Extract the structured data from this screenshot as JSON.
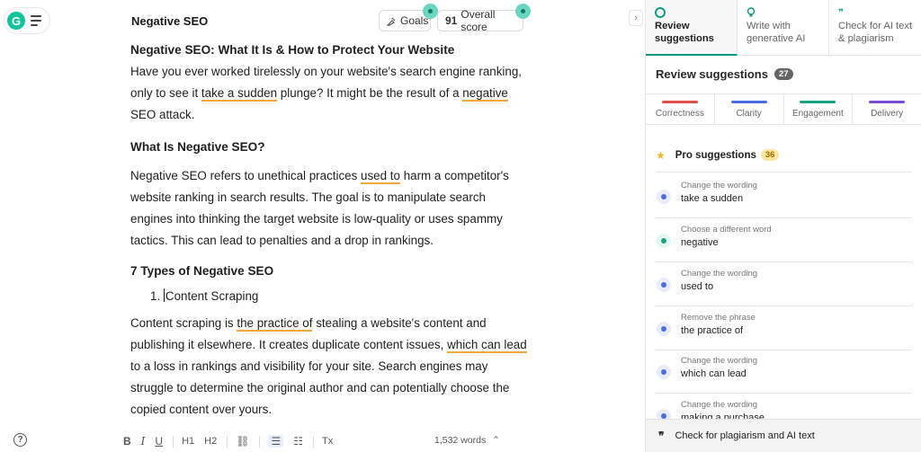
{
  "app": {
    "logo_letter": "G"
  },
  "editor": {
    "doc_title": "Negative SEO",
    "goals_label": "Goals",
    "score_value": "91",
    "score_label": "Overall score",
    "heading1": "Negative SEO: What It Is & How to Protect Your Website",
    "p1": {
      "a": "Have you ever worked tirelessly on your website's search engine ranking, only to see it ",
      "u1": "take a sudden",
      "b": " plunge? It might be the result of a ",
      "u2": "negative",
      "c": " SEO attack."
    },
    "heading2": "What Is Negative SEO?",
    "p2": {
      "a": "Negative SEO refers to unethical practices ",
      "u1": "used to",
      "b": " harm a competitor's website ranking in search results. The goal is to manipulate search engines into thinking the target website is low-quality or uses spammy tactics. This can lead to penalties and a drop in rankings."
    },
    "heading3": "7 Types of Negative SEO",
    "list_number": "1.",
    "list_item": "Content Scraping",
    "p3": {
      "a": "Content scraping is ",
      "u1": "the practice of",
      "b": " stealing a website's content and publishing it elsewhere. It creates duplicate content issues, ",
      "u2": "which can lead",
      "c": " to a loss in rankings and visibility for your site. Search engines may struggle to determine the original author and can potentially choose the copied content over yours."
    },
    "toolbar": {
      "bold": "B",
      "italic": "I",
      "underline": "U",
      "h1": "H1",
      "h2": "H2",
      "link": "⛓",
      "ordered_list": "☰",
      "bullet_list": "☷",
      "clear_format": "Tx"
    },
    "word_count": "1,532 words",
    "help": "?"
  },
  "sidebar": {
    "tabs": [
      {
        "label": "Review suggestions",
        "icon": "grammarly-icon"
      },
      {
        "label": "Write with generative AI",
        "icon": "bulb-icon"
      },
      {
        "label": "Check for AI text & plagiarism",
        "icon": "quote-icon"
      }
    ],
    "header": "Review suggestions",
    "header_count": "27",
    "categories": [
      {
        "label": "Correctness",
        "color": "#e0504a"
      },
      {
        "label": "Clarity",
        "color": "#4a6ee0"
      },
      {
        "label": "Engagement",
        "color": "#16a37f"
      },
      {
        "label": "Delivery",
        "color": "#7b4ad6"
      }
    ],
    "pro_label": "Pro suggestions",
    "pro_count": "36",
    "suggestions": [
      {
        "label": "Change the wording",
        "text": "take a sudden",
        "kind": "clarity"
      },
      {
        "label": "Choose a different word",
        "text": "negative",
        "kind": "engagement"
      },
      {
        "label": "Change the wording",
        "text": "used to",
        "kind": "clarity"
      },
      {
        "label": "Remove the phrase",
        "text": "the practice of",
        "kind": "clarity"
      },
      {
        "label": "Change the wording",
        "text": "which can lead",
        "kind": "clarity"
      },
      {
        "label": "Change the wording",
        "text": "making a purchase",
        "kind": "clarity"
      }
    ],
    "bottom_label": "Check for plagiarism and AI text"
  }
}
